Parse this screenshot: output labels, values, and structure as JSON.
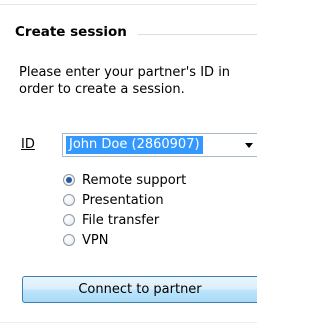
{
  "session": {
    "title": "Create session",
    "description": "Please enter your partner's ID in order to create a session.",
    "id_label": "ID",
    "id_value": "John Doe (2860907)",
    "options": [
      {
        "label": "Remote support",
        "checked": true
      },
      {
        "label": "Presentation",
        "checked": false
      },
      {
        "label": "File transfer",
        "checked": false
      },
      {
        "label": "VPN",
        "checked": false
      }
    ],
    "connect_label": "Connect to partner"
  },
  "icons": {
    "dropdown": "chevron-down-icon",
    "radio_selected": "radio-selected-icon",
    "radio_unselected": "radio-unselected-icon"
  },
  "colors": {
    "selection_highlight": "#3399ff",
    "button_border": "#3c7fb1",
    "radio_dot": "#2557a8"
  }
}
